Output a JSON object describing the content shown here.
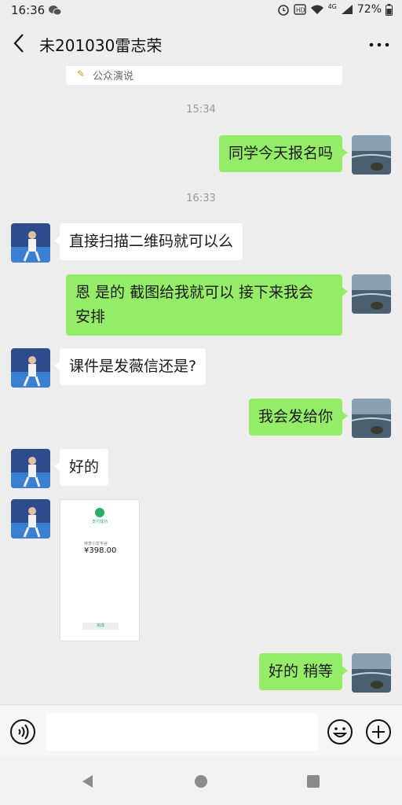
{
  "status_bar": {
    "time": "16:36",
    "network": "4G",
    "battery": "72%"
  },
  "header": {
    "title": "未201030雷志荣"
  },
  "card_strip": {
    "text": "公众演说"
  },
  "timestamps": [
    "15:34",
    "16:33"
  ],
  "messages": [
    {
      "side": "out",
      "text": "同学今天报名吗"
    },
    {
      "side": "in",
      "text": "直接扫描二维码就可以么"
    },
    {
      "side": "out",
      "line1": "恩 是的 截图给我就可以  接下来我会",
      "line2": "安排"
    },
    {
      "side": "in",
      "text": "课件是发薇信还是?"
    },
    {
      "side": "out",
      "text": "我会发给你"
    },
    {
      "side": "in",
      "text": "好的"
    },
    {
      "side": "out",
      "text": "好的 稍等"
    }
  ],
  "payment_image": {
    "status": "支付成功",
    "payee": "待李小龙平谷",
    "amount": "¥398.00",
    "done": "完成"
  },
  "input": {
    "value": ""
  },
  "colors": {
    "outgoing_bubble": "#95ec69",
    "incoming_bubble": "#ffffff",
    "background": "#ededed"
  }
}
